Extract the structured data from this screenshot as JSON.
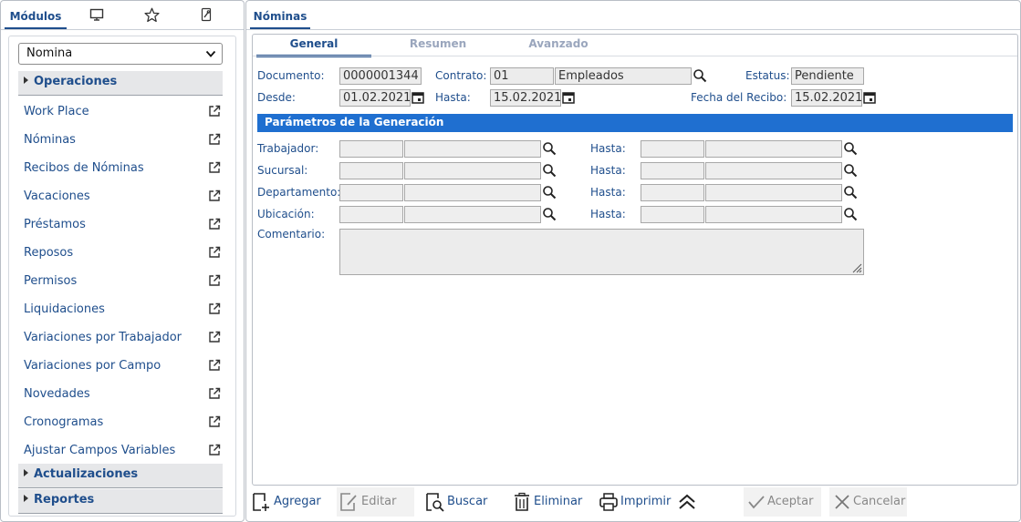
{
  "left": {
    "tabs": {
      "modules_label": "Módulos",
      "icons": [
        "monitor-icon",
        "star-icon",
        "wrench-icon"
      ]
    },
    "module_select": {
      "value": "Nomina"
    },
    "sections": {
      "operaciones": "Operaciones",
      "actualizaciones": "Actualizaciones",
      "reportes": "Reportes"
    },
    "menu_items": [
      "Work Place",
      "Nóminas",
      "Recibos de Nóminas",
      "Vacaciones",
      "Préstamos",
      "Reposos",
      "Permisos",
      "Liquidaciones",
      "Variaciones por Trabajador",
      "Variaciones por Campo",
      "Novedades",
      "Cronogramas",
      "Ajustar Campos Variables"
    ]
  },
  "right": {
    "tab_label": "Nóminas",
    "subtabs": {
      "general": "General",
      "resumen": "Resumen",
      "avanzado": "Avanzado"
    },
    "form": {
      "documento_label": "Documento:",
      "documento_value": "0000001344",
      "contrato_label": "Contrato:",
      "contrato_code": "01",
      "contrato_name": "Empleados",
      "estatus_label": "Estatus:",
      "estatus_value": "Pendiente",
      "desde_label": "Desde:",
      "desde_value": "01.02.2021",
      "hasta_label": "Hasta:",
      "hasta_value": "15.02.2021",
      "fecha_recibo_label": "Fecha del Recibo:",
      "fecha_recibo_value": "15.02.2021"
    },
    "params": {
      "title": "Parámetros de la Generación",
      "trabajador_label": "Trabajador:",
      "sucursal_label": "Sucursal:",
      "departamento_label": "Departamento:",
      "ubicacion_label": "Ubicación:",
      "hasta_label": "Hasta:",
      "comentario_label": "Comentario:"
    },
    "toolbar": {
      "agregar": "Agregar",
      "editar": "Editar",
      "buscar": "Buscar",
      "eliminar": "Eliminar",
      "imprimir": "Imprimir",
      "aceptar": "Aceptar",
      "cancelar": "Cancelar"
    }
  }
}
